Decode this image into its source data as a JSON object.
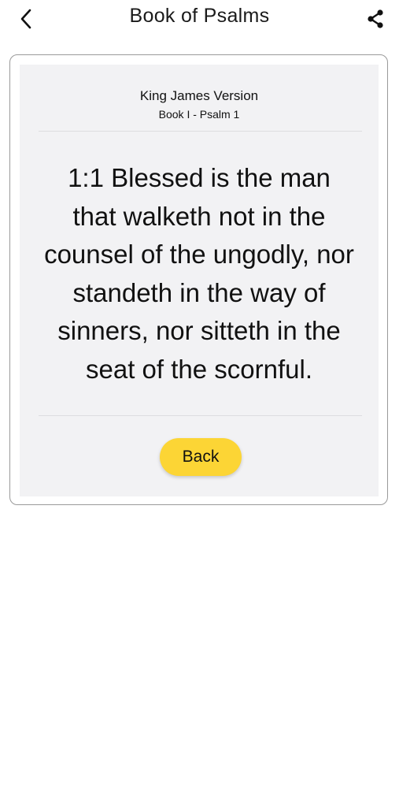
{
  "header": {
    "title": "Book of Psalms",
    "back_icon": "chevron-left-icon",
    "share_icon": "share-icon"
  },
  "card": {
    "version": "King James Version",
    "reference": "Book I - Psalm 1",
    "verse": "1:1 Blessed is the man that walketh not in the counsel of the ungodly, nor standeth in the way of sinners, nor sitteth in the seat of the scornful.",
    "back_label": "Back"
  },
  "colors": {
    "button": "#fcd535",
    "card_background": "#f2f2f4",
    "card_border": "#9a9a9a"
  }
}
